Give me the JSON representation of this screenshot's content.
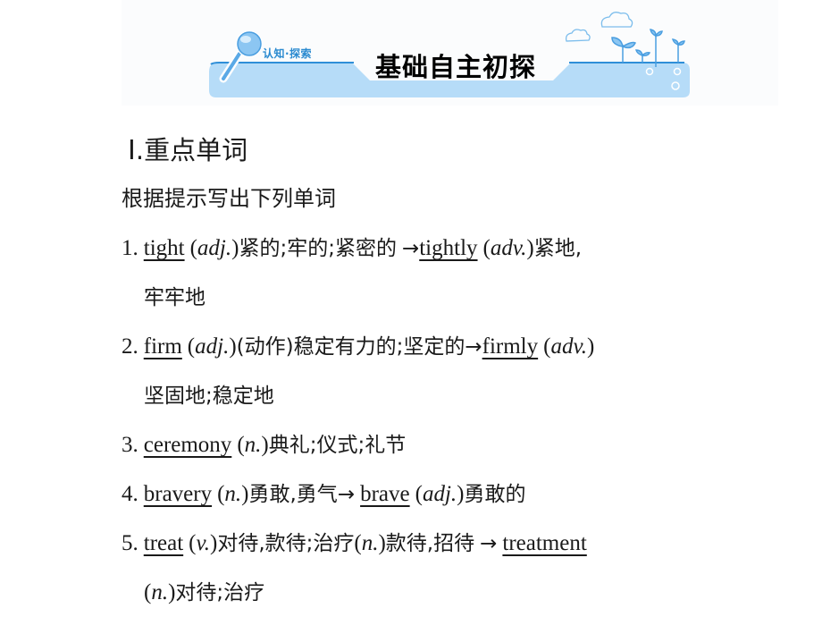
{
  "banner": {
    "subtitle": "认知·探索",
    "title": "基础自主初探",
    "colors": {
      "band": "#b6dcf8",
      "line": "#2f8fd8",
      "text_accent": "#2a8ad0"
    }
  },
  "section": {
    "numeral": "Ⅰ",
    "title": ".重点单词",
    "instruction": "根据提示写出下列单词"
  },
  "items": [
    {
      "num": "1.",
      "word": "tight",
      "pos": "adj.",
      "meaning": "紧的;牢的;紧密的",
      "arrow": "→",
      "derived": "tightly",
      "derived_pos": "adv.",
      "derived_meaning": "紧地,",
      "continuation": "牢牢地"
    },
    {
      "num": "2.",
      "word": "firm",
      "pos": "adj.",
      "meaning": "(动作)稳定有力的;坚定的",
      "arrow": "→",
      "derived": "firmly",
      "derived_pos": "adv.",
      "derived_meaning": "",
      "continuation": "坚固地;稳定地"
    },
    {
      "num": "3.",
      "word": "ceremony",
      "pos": "n.",
      "meaning": "典礼;仪式;礼节"
    },
    {
      "num": "4.",
      "word": "bravery",
      "pos": "n.",
      "meaning": "勇敢,勇气",
      "arrow": "→",
      "derived": "brave",
      "derived_pos": "adj.",
      "derived_meaning": "勇敢的"
    },
    {
      "num": "5.",
      "word": "treat",
      "pos": "v.",
      "meaning": "对待,款待;治疗",
      "pos2": "n.",
      "meaning2": "款待,招待",
      "arrow": "→",
      "derived": "treatment",
      "continuation_pos": "n.",
      "continuation": "对待;治疗"
    }
  ]
}
